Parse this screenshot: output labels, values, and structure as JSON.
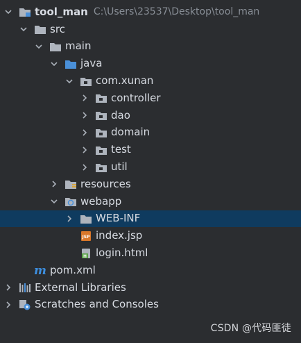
{
  "tree": {
    "items": [
      {
        "label": "tool_man",
        "path": "C:\\Users\\23537\\Desktop\\tool_man",
        "icon": "module-folder-icon",
        "expanded": true,
        "depth": 0
      },
      {
        "label": "src",
        "icon": "folder-icon",
        "expanded": true,
        "depth": 1
      },
      {
        "label": "main",
        "icon": "folder-icon",
        "expanded": true,
        "depth": 2
      },
      {
        "label": "java",
        "icon": "source-folder-icon",
        "expanded": true,
        "depth": 3
      },
      {
        "label": "com.xunan",
        "icon": "package-icon",
        "expanded": true,
        "depth": 4
      },
      {
        "label": "controller",
        "icon": "package-icon",
        "expanded": false,
        "depth": 5
      },
      {
        "label": "dao",
        "icon": "package-icon",
        "expanded": false,
        "depth": 5
      },
      {
        "label": "domain",
        "icon": "package-icon",
        "expanded": false,
        "depth": 5
      },
      {
        "label": "test",
        "icon": "package-icon",
        "expanded": false,
        "depth": 5
      },
      {
        "label": "util",
        "icon": "package-icon",
        "expanded": false,
        "depth": 5
      },
      {
        "label": "resources",
        "icon": "resources-folder-icon",
        "expanded": false,
        "depth": 3
      },
      {
        "label": "webapp",
        "icon": "web-folder-icon",
        "expanded": true,
        "depth": 3
      },
      {
        "label": "WEB-INF",
        "icon": "folder-icon",
        "expanded": false,
        "depth": 4,
        "selected": true
      },
      {
        "label": "index.jsp",
        "icon": "jsp-file-icon",
        "depth": 4
      },
      {
        "label": "login.html",
        "icon": "html-file-icon",
        "depth": 4
      },
      {
        "label": "pom.xml",
        "icon": "maven-file-icon",
        "depth": 1
      },
      {
        "label": "External Libraries",
        "icon": "libraries-icon",
        "expanded": false,
        "depth": 0
      },
      {
        "label": "Scratches and Consoles",
        "icon": "scratches-icon",
        "expanded": false,
        "depth": 0
      }
    ]
  },
  "watermark": "CSDN @代码匪徒",
  "colors": {
    "background": "#2b2d30",
    "selection": "#0f3b5f",
    "text": "#d7dbe2",
    "path_text": "#888e96",
    "folder": "#aeb4bd",
    "source_folder": "#4a90d9",
    "jsp": "#d9772a",
    "html": "#5aa34a",
    "maven": "#3d8fe0"
  }
}
